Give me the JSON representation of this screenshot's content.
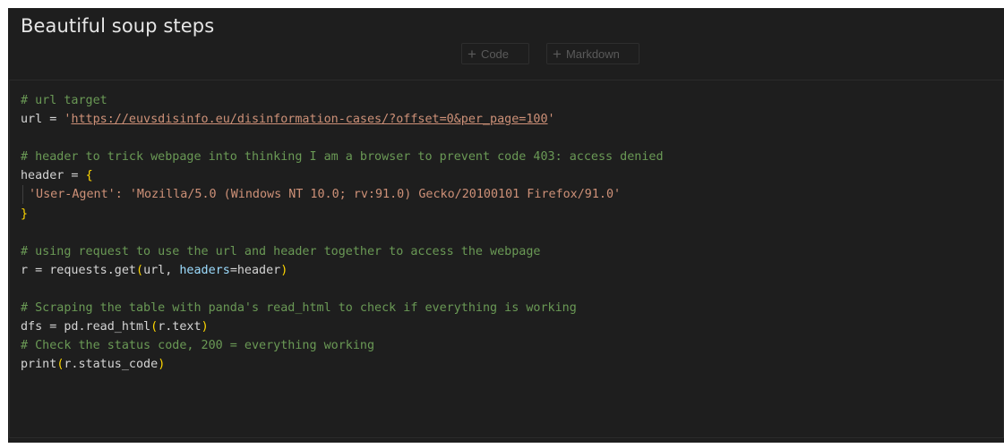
{
  "markdown_cell": {
    "title": "Beautiful soup steps"
  },
  "toolbar": {
    "add_code_label": "Code",
    "add_markdown_label": "Markdown"
  },
  "code": {
    "l1": "# url target",
    "l2_var": "url",
    "l2_eq": " = ",
    "l2_q1": "'",
    "l2_url": "https://euvsdisinfo.eu/disinformation-cases/?offset=0&per_page=100",
    "l2_q2": "'",
    "l4": "# header to trick webpage into thinking I am a browser to prevent code 403: access denied",
    "l5_var": "header",
    "l5_eq": " = ",
    "l5_brace": "{",
    "l6_str": "'User-Agent': 'Mozilla/5.0 (Windows NT 10.0; rv:91.0) Gecko/20100101 Firefox/91.0'",
    "l7_brace": "}",
    "l9": "# using request to use the url and header together to access the webpage",
    "l10_a": "r = requests.get",
    "l10_p1": "(",
    "l10_b": "url, ",
    "l10_kw": "headers",
    "l10_c": "=header",
    "l10_p2": ")",
    "l12": "# Scraping the table with panda's read_html to check if everything is working",
    "l13_a": "dfs = pd.read_html",
    "l13_p1": "(",
    "l13_b": "r.text",
    "l13_p2": ")",
    "l14": "# Check the status code, 200 = everything working",
    "l15_a": "print",
    "l15_p1": "(",
    "l15_b": "r.status_code",
    "l15_p2": ")"
  },
  "colors": {
    "comment": "#6a9955",
    "string": "#ce9178",
    "bracket": "#ffd700",
    "param": "#9cdcfe",
    "default": "#d4d4d4",
    "background": "#1e1e1e"
  }
}
